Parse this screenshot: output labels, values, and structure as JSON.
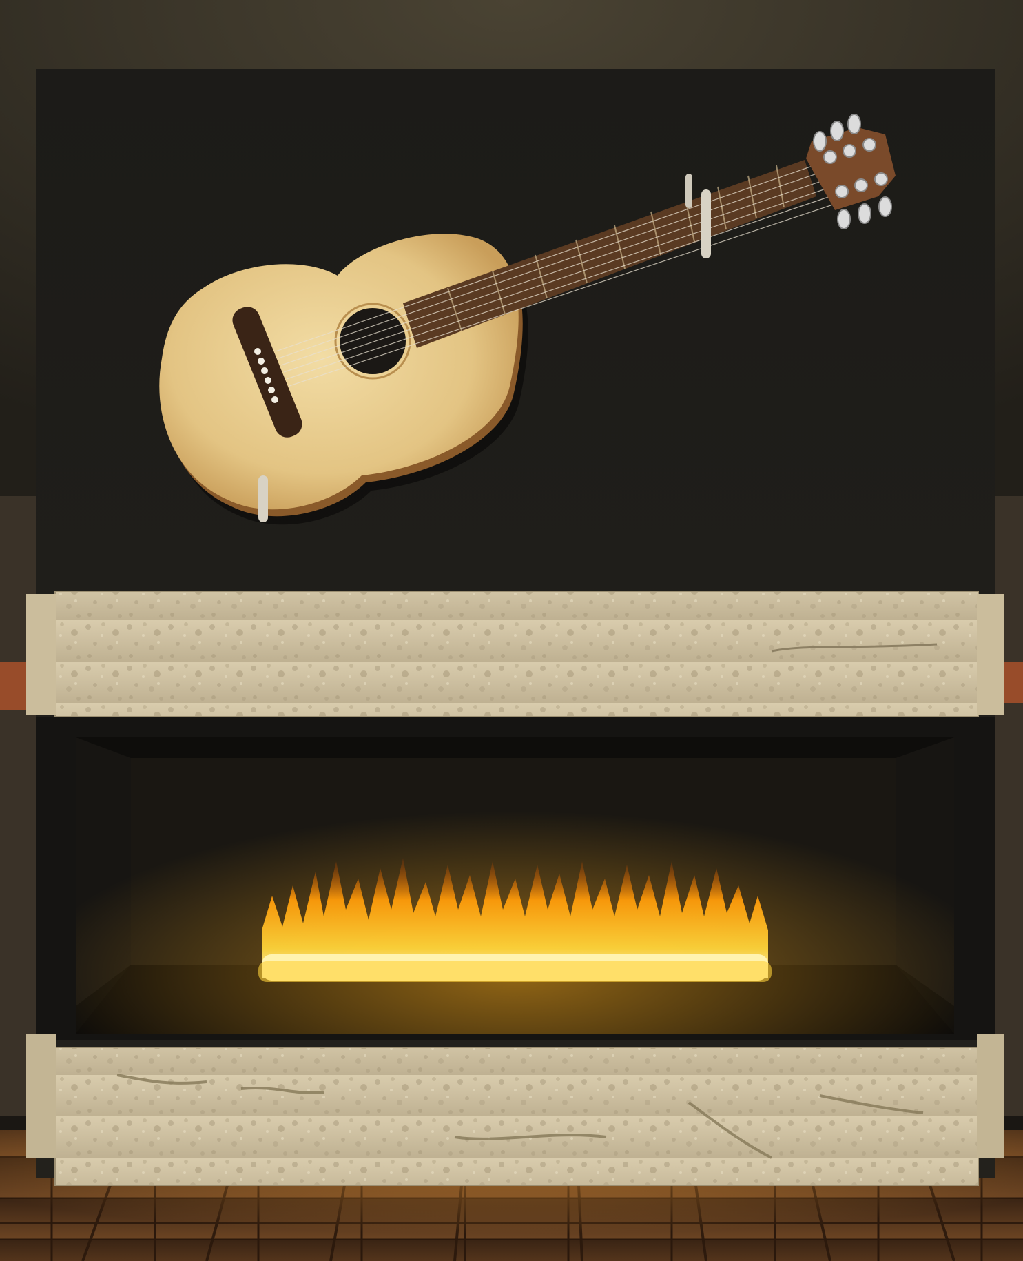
{
  "scene": {
    "subject": "guitar-over-fireplace",
    "colors": {
      "ceiling": "#2e2a21",
      "wall_panel": "#1f1e1a",
      "stone": "#cdbf9f",
      "stone_dark": "#9c8f72",
      "firebox": "#0e0d0b",
      "flame_core": "#fff6b0",
      "flame_mid": "#ffc21a",
      "flame_outer": "#ff8a00",
      "guitar_body": "#e7c98a",
      "guitar_edge": "#8a5a2a",
      "fretboard": "#5a3a22",
      "headstock": "#7a4a2a",
      "floor": "#5b3a1f"
    }
  }
}
